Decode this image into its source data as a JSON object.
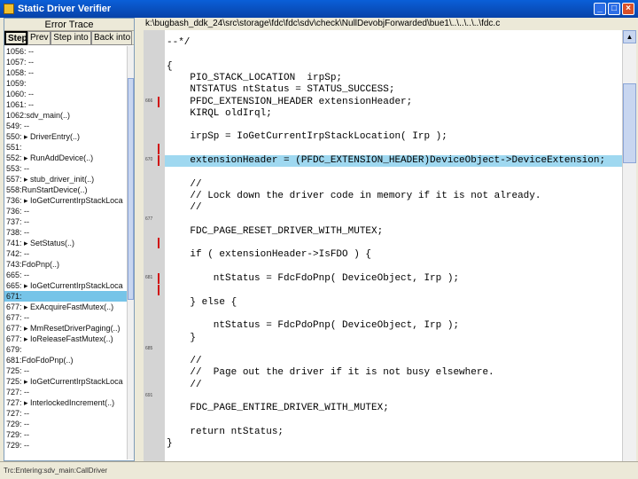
{
  "window": {
    "title": "Static Driver Verifier",
    "minimize": "_",
    "maximize": "□",
    "close": "×"
  },
  "trace_pane": {
    "header": "Error Trace",
    "buttons": [
      "Step",
      "Prev",
      "Step into",
      "Back into"
    ],
    "items": [
      "1056: --",
      "1057: --",
      "1058: --",
      "1059:",
      "1060: --",
      "1061: --",
      "1062:sdv_main(..)",
      "549: --",
      "550: ▸ DriverEntry(..)",
      "551:",
      "552: ▸ RunAddDevice(..)",
      "553: --",
      "557: ▸ stub_driver_init(..)",
      "558:RunStartDevice(..)",
      "736: ▸ IoGetCurrentIrpStackLoca",
      "736: --",
      "737: --",
      "738: --",
      "741: ▸ SetStatus(..)",
      "742: --",
      "743:FdoPnp(..)",
      "665: --",
      "665: ▸ IoGetCurrentIrpStackLoca",
      "671:",
      "677: ▸ ExAcquireFastMutex(..)",
      "677: --",
      "677: ▸ MmResetDriverPaging(..)",
      "677: ▸ IoReleaseFastMutex(..)",
      "679:",
      "681:FdoFdoPnp(..)",
      "725: --",
      "725: ▸ IoGetCurrentIrpStackLoca",
      "727: --",
      "727: ▸ InterlockedIncrement(..)",
      "727: --",
      "729: --",
      "729: --",
      "729: --"
    ],
    "selected_index": 23
  },
  "path": "k:\\bugbash_ddk_24\\src\\storage\\fdc\\fdc\\sdv\\check\\NullDevobjForwarded\\bue1\\..\\..\\..\\..\\fdc.c",
  "gutter": {
    "labels": [
      "666",
      "670",
      "677",
      "681",
      "685",
      "691"
    ]
  },
  "code_lines": [
    "--*/",
    "",
    "{",
    "    PIO_STACK_LOCATION  irpSp;",
    "    NTSTATUS ntStatus = STATUS_SUCCESS;",
    "    PFDC_EXTENSION_HEADER extensionHeader;",
    "    KIRQL oldIrql;",
    "",
    "    irpSp = IoGetCurrentIrpStackLocation( Irp );",
    "",
    "    extensionHeader = (PFDC_EXTENSION_HEADER)DeviceObject->DeviceExtension;",
    "",
    "    //",
    "    // Lock down the driver code in memory if it is not already.",
    "    //",
    "",
    "    FDC_PAGE_RESET_DRIVER_WITH_MUTEX;",
    "",
    "    if ( extensionHeader->IsFDO ) {",
    "",
    "        ntStatus = FdcFdoPnp( DeviceObject, Irp );",
    "",
    "    } else {",
    "",
    "        ntStatus = FdcPdoPnp( DeviceObject, Irp );",
    "    }",
    "",
    "    //",
    "    //  Page out the driver if it is not busy elsewhere.",
    "    //",
    "",
    "    FDC_PAGE_ENTIRE_DRIVER_WITH_MUTEX;",
    "",
    "    return ntStatus;",
    "}"
  ],
  "highlighted_line": 10,
  "statusbar": "Trc:Entering:sdv_main:CallDriver"
}
